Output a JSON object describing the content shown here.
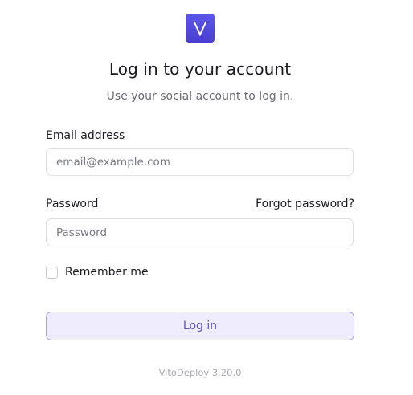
{
  "brand": {
    "logo_icon": "v-logo-icon",
    "accent_color": "#4f46e5"
  },
  "header": {
    "title": "Log in to your account",
    "subtitle": "Use your social account to log in."
  },
  "form": {
    "email": {
      "label": "Email address",
      "value": "",
      "placeholder": "email@example.com"
    },
    "password": {
      "label": "Password",
      "value": "",
      "placeholder": "Password",
      "forgot_link": "Forgot password?"
    },
    "remember": {
      "label": "Remember me",
      "checked": false
    },
    "submit_label": "Log in"
  },
  "footer": {
    "version": "VitoDeploy 3.20.0"
  }
}
